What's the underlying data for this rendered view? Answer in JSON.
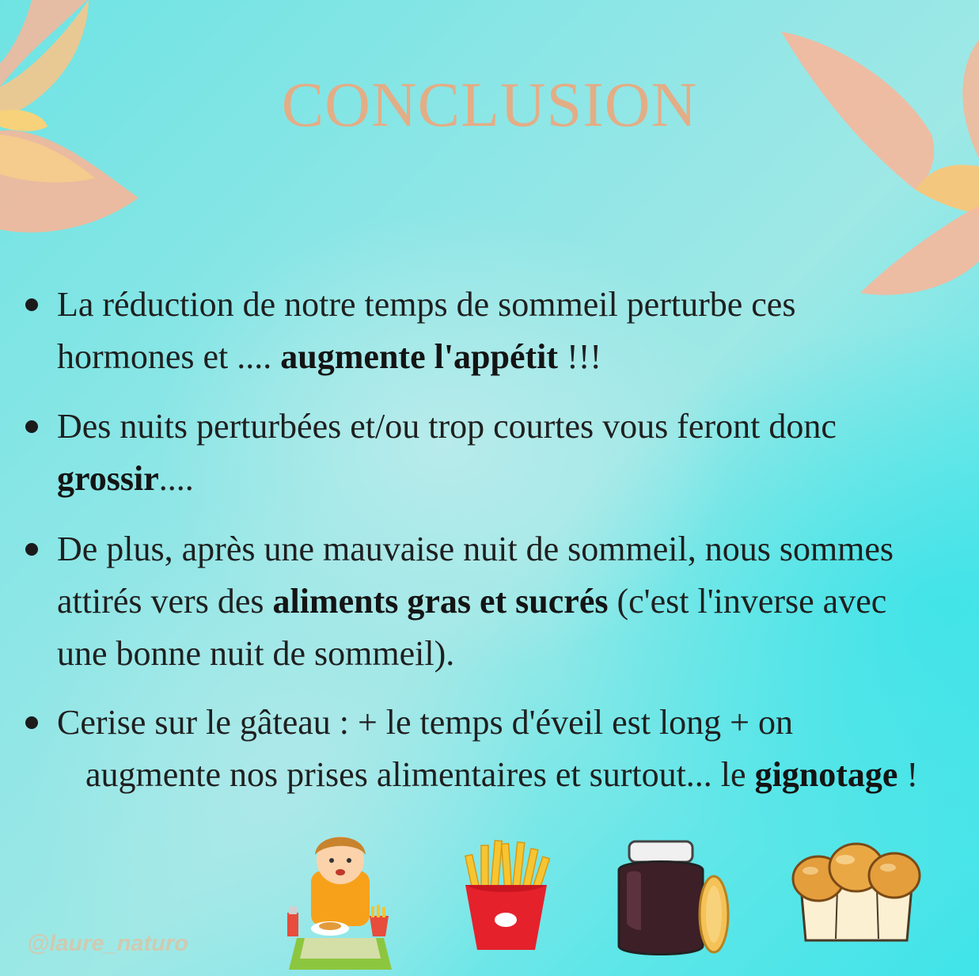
{
  "title": "CONCLUSION",
  "bullets": [
    {
      "line1": "La réduction de notre temps de sommeil perturbe ces",
      "line2_pre": "hormones et .... ",
      "line2_bold": "augmente l'appétit",
      "line2_post": " !!!"
    },
    {
      "line1": "Des nuits perturbées et/ou trop courtes vous feront donc",
      "line2_bold": "grossir",
      "line2_post": "...."
    },
    {
      "line1": "De plus, après une mauvaise nuit de sommeil, nous sommes",
      "line2_pre": "attirés vers des ",
      "line2_bold": "aliments gras et sucrés",
      "line2_post": " (c'est l'inverse avec",
      "line3": "une bonne nuit de sommeil)."
    },
    {
      "line1": "Cerise sur le gâteau : + le temps d'éveil est long + on",
      "line2_pre": "augmente nos prises alimentaires et surtout... le ",
      "line2_bold": "gignotage",
      "line2_post": " !"
    }
  ],
  "handle": "@laure_naturo",
  "illustrations": [
    "child-eating-icon",
    "french-fries-icon",
    "chocolate-spread-jar-icon",
    "brioche-bread-icon"
  ],
  "colors": {
    "background": "#7fe6e6",
    "title": "#e3ad86",
    "text": "#1f1f1f",
    "petal": "#f3b79a"
  }
}
